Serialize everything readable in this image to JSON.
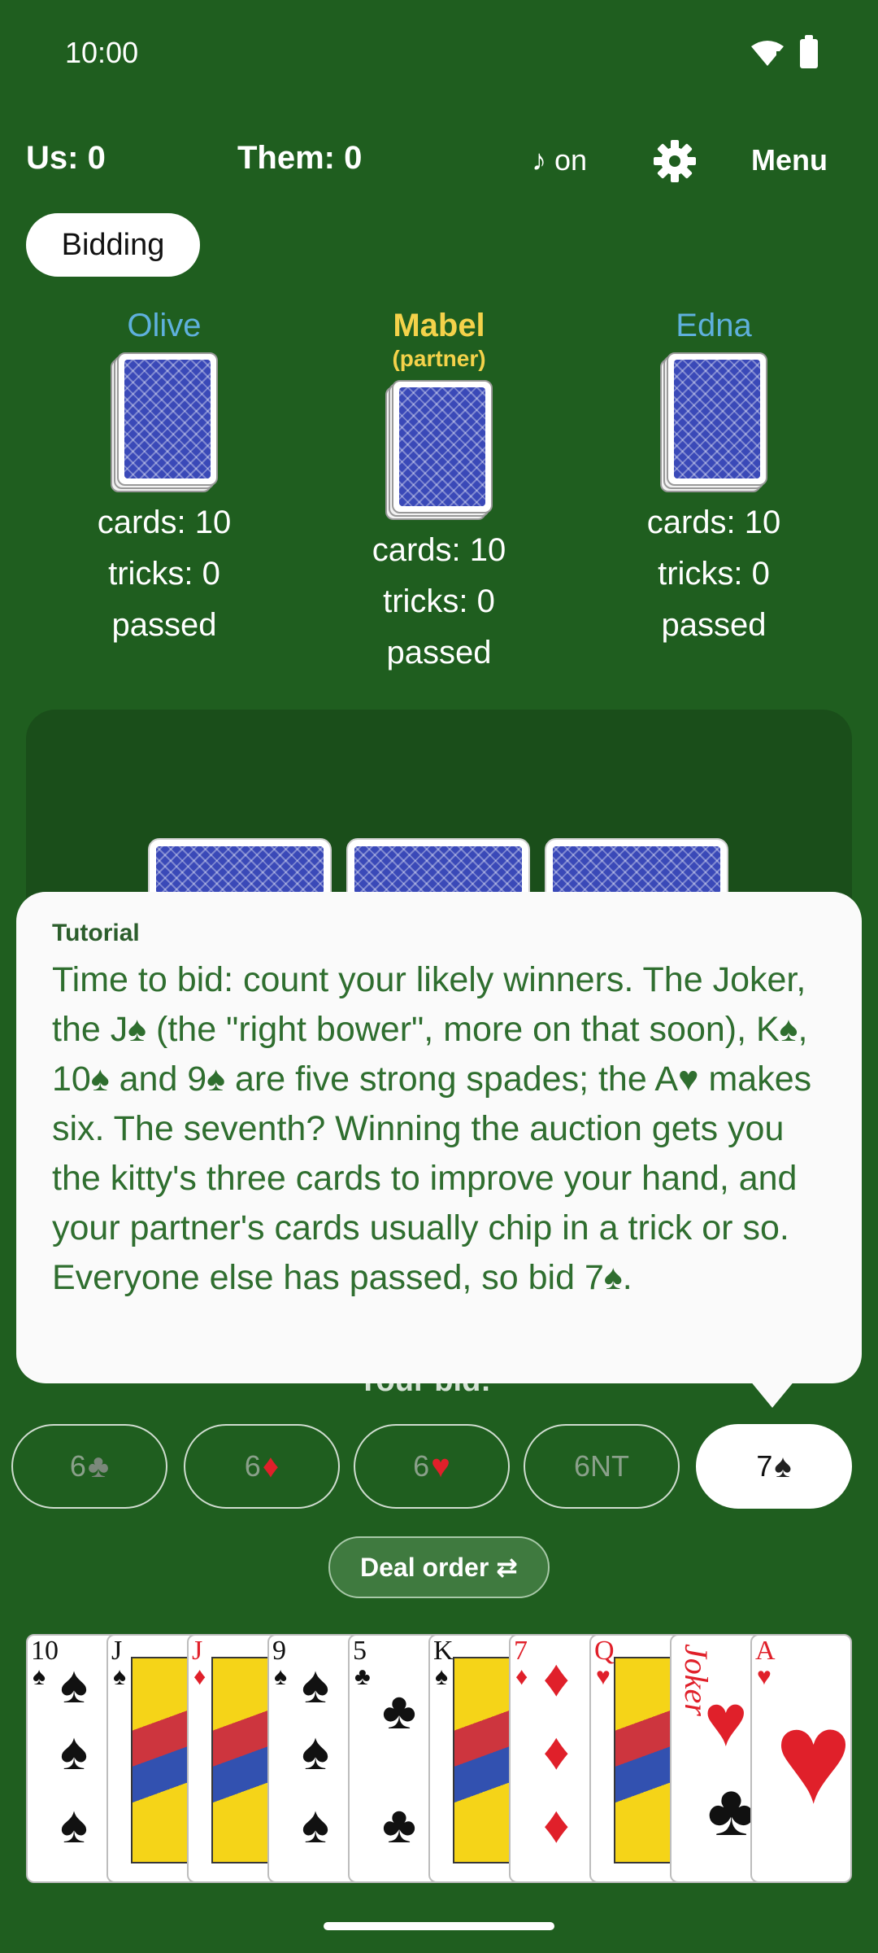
{
  "status_bar": {
    "time": "10:00"
  },
  "top_bar": {
    "us_score": "Us: 0",
    "them_score": "Them: 0",
    "music": "♪ on",
    "menu": "Menu",
    "phase": "Bidding"
  },
  "players": {
    "left": {
      "name": "Olive",
      "cards": "cards: 10",
      "tricks": "tricks: 0",
      "status": "passed"
    },
    "top": {
      "name": "Mabel",
      "tag": "(partner)",
      "cards": "cards: 10",
      "tricks": "tricks: 0",
      "status": "passed"
    },
    "right": {
      "name": "Edna",
      "cards": "cards: 10",
      "tricks": "tricks: 0",
      "status": "passed"
    }
  },
  "tutorial": {
    "title": "Tutorial",
    "text": "Time to bid: count your likely winners. The Joker, the J♠ (the \"right bower\", more on that soon), K♠, 10♠ and 9♠ are five strong spades; the A♥ makes six. The seventh? Winning the auction gets you the kitty's three cards to improve your hand, and your partner's cards usually chip in a trick or so. Everyone else has passed, so bid 7♠."
  },
  "bid_prompt": "Your bid:",
  "bids": [
    {
      "rank": "6",
      "suit": "♣"
    },
    {
      "rank": "6",
      "suit": "♦"
    },
    {
      "rank": "6",
      "suit": "♥"
    },
    {
      "rank": "6NT",
      "suit": ""
    },
    {
      "rank": "7",
      "suit": "♠",
      "selected": true
    }
  ],
  "deal_order": "Deal order ⇄",
  "hand": [
    {
      "rank": "10",
      "suit": "♠"
    },
    {
      "rank": "J",
      "suit": "♠"
    },
    {
      "rank": "J",
      "suit": "♦"
    },
    {
      "rank": "9",
      "suit": "♠"
    },
    {
      "rank": "5",
      "suit": "♣"
    },
    {
      "rank": "K",
      "suit": "♠"
    },
    {
      "rank": "7",
      "suit": "♦"
    },
    {
      "rank": "Q",
      "suit": "♥"
    },
    {
      "rank": "Joker",
      "suit": ""
    },
    {
      "rank": "A",
      "suit": "♥"
    }
  ],
  "colors": {
    "felt": "#1f5e1f",
    "table": "#1a4e1a",
    "opponent_name": "#5fb0dd",
    "partner_name": "#f4d24a",
    "card_back": "#3a49b8",
    "red_suit": "#e0202a"
  }
}
